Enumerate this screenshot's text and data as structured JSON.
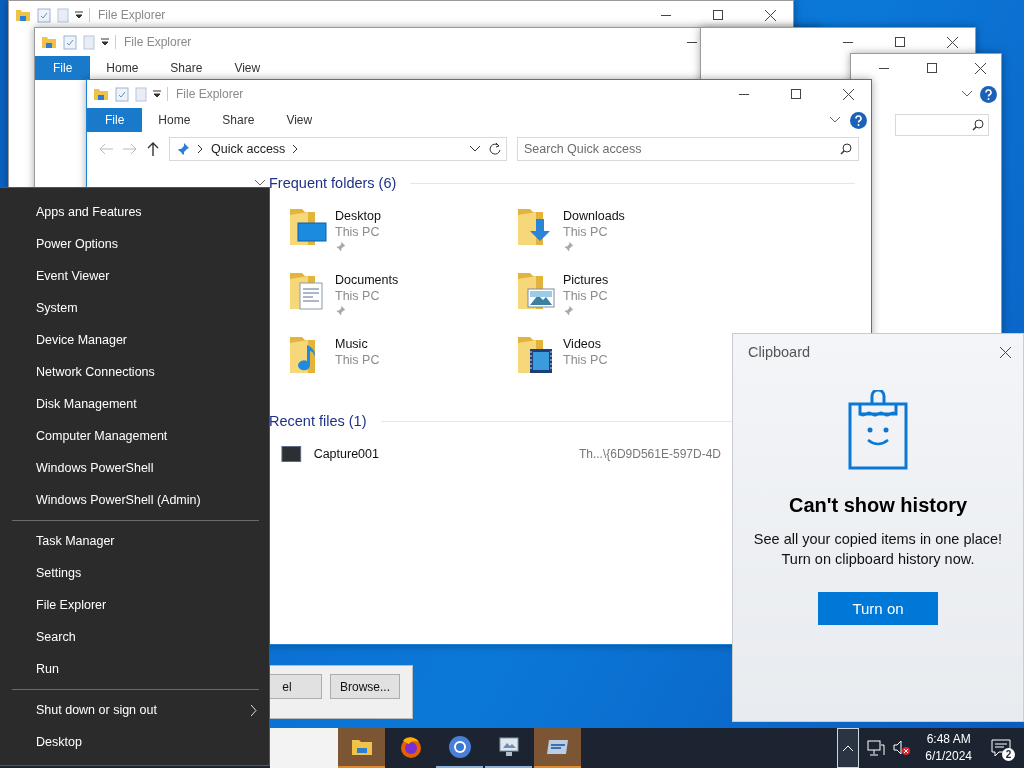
{
  "back_windows": [
    {
      "kind": "explorer",
      "title": "File Explorer"
    },
    {
      "kind": "explorer",
      "title": "File Explorer",
      "tabs": [
        {
          "label": "File",
          "selected": true
        },
        {
          "label": "Home",
          "selected": false
        },
        {
          "label": "Share",
          "selected": false
        },
        {
          "label": "View",
          "selected": false
        }
      ]
    },
    {
      "kind": "frame"
    },
    {
      "kind": "search_frame"
    }
  ],
  "explorer": {
    "title": "File Explorer",
    "tabs": [
      {
        "label": "File",
        "selected": true
      },
      {
        "label": "Home",
        "selected": false
      },
      {
        "label": "Share",
        "selected": false
      },
      {
        "label": "View",
        "selected": false
      }
    ],
    "address": "Quick access",
    "search": {
      "placeholder": "Search Quick access"
    },
    "sections": [
      {
        "kind": "folders",
        "heading": "Frequent folders (6)",
        "expanded": true,
        "items": [
          {
            "name": "Desktop",
            "location": "This PC",
            "pinned": true
          },
          {
            "name": "Downloads",
            "location": "This PC",
            "pinned": true
          },
          {
            "name": "Documents",
            "location": "This PC",
            "pinned": true
          },
          {
            "name": "Pictures",
            "location": "This PC",
            "pinned": true
          },
          {
            "name": "Music",
            "location": "This PC",
            "pinned": false
          },
          {
            "name": "Videos",
            "location": "This PC",
            "pinned": false
          }
        ]
      },
      {
        "kind": "files",
        "heading": "Recent files (1)",
        "expanded": true,
        "items": [
          {
            "name": "Capture001",
            "path": "Th...\\{6D9D561E-597D-4D"
          }
        ]
      }
    ]
  },
  "dialog": {
    "buttons": [
      "el",
      "Browse..."
    ]
  },
  "power_menu": {
    "groups": [
      [
        {
          "label": "Apps and Features",
          "submenu": false
        },
        {
          "label": "Power Options",
          "submenu": false
        },
        {
          "label": "Event Viewer",
          "submenu": false
        },
        {
          "label": "System",
          "submenu": false
        },
        {
          "label": "Device Manager",
          "submenu": false
        },
        {
          "label": "Network Connections",
          "submenu": false
        },
        {
          "label": "Disk Management",
          "submenu": false
        },
        {
          "label": "Computer Management",
          "submenu": false
        },
        {
          "label": "Windows PowerShell",
          "submenu": false
        },
        {
          "label": "Windows PowerShell (Admin)",
          "submenu": false
        }
      ],
      [
        {
          "label": "Task Manager",
          "submenu": false
        },
        {
          "label": "Settings",
          "submenu": false
        },
        {
          "label": "File Explorer",
          "submenu": false
        },
        {
          "label": "Search",
          "submenu": false
        },
        {
          "label": "Run",
          "submenu": false
        }
      ],
      [
        {
          "label": "Shut down or sign out",
          "submenu": true
        },
        {
          "label": "Desktop",
          "submenu": false
        }
      ]
    ]
  },
  "clipboard": {
    "title": "Clipboard",
    "heading": "Can't show history",
    "message": "See all your copied items in one place! Turn on clipboard history now.",
    "button": "Turn on"
  },
  "taskbar": {
    "apps": [
      {
        "running": true,
        "flashing": true
      },
      {
        "running": false,
        "flashing": false
      },
      {
        "running": true,
        "flashing": false
      },
      {
        "running": true,
        "flashing": false
      },
      {
        "running": true,
        "flashing": true
      }
    ],
    "tray": {
      "overflow_selected": true,
      "time": "6:48 AM",
      "date": "6/1/2024",
      "notifications": "2"
    }
  }
}
